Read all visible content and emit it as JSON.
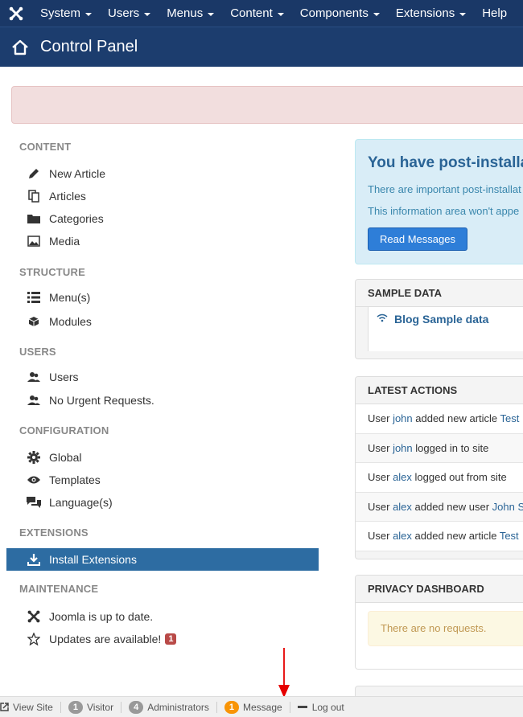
{
  "navbar": {
    "items": [
      "System",
      "Users",
      "Menus",
      "Content",
      "Components",
      "Extensions",
      "Help"
    ]
  },
  "header": {
    "title": "Control Panel"
  },
  "sidebar": {
    "content": {
      "heading": "CONTENT",
      "items": [
        {
          "label": "New Article",
          "icon": "pencil-icon"
        },
        {
          "label": "Articles",
          "icon": "copy-icon"
        },
        {
          "label": "Categories",
          "icon": "folder-icon"
        },
        {
          "label": "Media",
          "icon": "image-icon"
        }
      ]
    },
    "structure": {
      "heading": "STRUCTURE",
      "items": [
        {
          "label": "Menu(s)",
          "icon": "list-icon"
        },
        {
          "label": "Modules",
          "icon": "cube-icon"
        }
      ]
    },
    "users": {
      "heading": "USERS",
      "items": [
        {
          "label": "Users",
          "icon": "users-icon"
        },
        {
          "label": "No Urgent Requests.",
          "icon": "users-icon"
        }
      ]
    },
    "configuration": {
      "heading": "CONFIGURATION",
      "items": [
        {
          "label": "Global",
          "icon": "cog-icon"
        },
        {
          "label": "Templates",
          "icon": "eye-icon"
        },
        {
          "label": "Language(s)",
          "icon": "comments-icon"
        }
      ]
    },
    "extensions": {
      "heading": "EXTENSIONS",
      "items": [
        {
          "label": "Install Extensions",
          "icon": "download-icon"
        }
      ]
    },
    "maintenance": {
      "heading": "MAINTENANCE",
      "items": [
        {
          "label": "Joomla is up to date.",
          "icon": "joomla-icon"
        },
        {
          "label": "Updates are available!",
          "icon": "star-icon",
          "badge": "1"
        }
      ]
    }
  },
  "post_install": {
    "title": "You have post-installa",
    "line1": "There are important post-installat",
    "line2": "This information area won't appe",
    "button": "Read Messages"
  },
  "sample_data": {
    "title": "SAMPLE DATA",
    "item": "Blog Sample data"
  },
  "latest_actions": {
    "title": "LATEST ACTIONS",
    "rows": [
      {
        "pre": "User ",
        "user": "john",
        "mid": " added new article ",
        "link": "Test"
      },
      {
        "pre": "User ",
        "user": "john",
        "mid": " logged in to site",
        "link": ""
      },
      {
        "pre": "User ",
        "user": "alex",
        "mid": " logged out from site",
        "link": ""
      },
      {
        "pre": "User ",
        "user": "alex",
        "mid": " added new user ",
        "link": "John S"
      },
      {
        "pre": "User ",
        "user": "alex",
        "mid": " added new article ",
        "link": "Test"
      }
    ]
  },
  "privacy": {
    "title": "PRIVACY DASHBOARD",
    "message": "There are no requests."
  },
  "statusbar": {
    "view_site": "View Site",
    "visitor_count": "1",
    "visitor_label": "Visitor",
    "admin_count": "4",
    "admin_label": "Administrators",
    "message_count": "1",
    "message_label": "Message",
    "logout": "Log out"
  },
  "colors": {
    "navbar": "#1a3867",
    "header": "#1c3d6e",
    "active_item": "#2d6ca2",
    "annotation_arrow": "#e60000"
  }
}
